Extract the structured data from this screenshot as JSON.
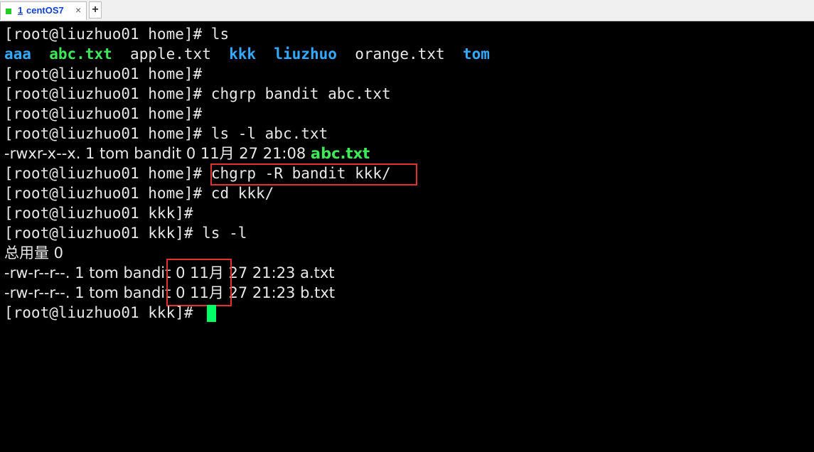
{
  "tab": {
    "number": "1",
    "title": "centOS7",
    "close": "×",
    "new_tab": "+"
  },
  "terminal": {
    "l1_prompt": "[root@liuzhuo01 home]#",
    "l1_cmd": " ls",
    "l2": {
      "aaa": "aaa",
      "abc": "abc.txt",
      "apple": "apple.txt",
      "kkk": "kkk",
      "liuzhuo": "liuzhuo",
      "orange": "orange.txt",
      "tom": "tom"
    },
    "l3": "[root@liuzhuo01 home]#",
    "l4_prompt": "[root@liuzhuo01 home]#",
    "l4_cmd": " chgrp bandit abc.txt",
    "l5": "[root@liuzhuo01 home]#",
    "l6_prompt": "[root@liuzhuo01 home]#",
    "l6_cmd": " ls -l abc.txt",
    "l7_meta": "-rwxr-x--x. 1 tom bandit 0 11月 27 21:08 ",
    "l7_file": "abc.txt",
    "l8_prompt": "[root@liuzhuo01 home]#",
    "l8_cmd": "chgrp -R bandit kkk/",
    "l9_prompt": "[root@liuzhuo01 home]#",
    "l9_cmd": " cd kkk/",
    "l10": "[root@liuzhuo01 kkk]#",
    "l11_prompt": "[root@liuzhuo01 kkk]#",
    "l11_cmd": " ls -l",
    "l12": "总用量 0",
    "l13_pre": "-rw-r--r--. 1 tom ",
    "l13_group": "bandit",
    "l13_post": " 0 11月 27 21:23 a.txt",
    "l14_pre": "-rw-r--r--. 1 tom ",
    "l14_group": "bandit",
    "l14_post": " 0 11月 27 21:23 b.txt",
    "l15_prompt": "[root@liuzhuo01 kkk]#"
  },
  "colors": {
    "directory": "#33aaff",
    "executable": "#3de85b",
    "highlight": "#e03030",
    "cursor": "#00ff66"
  }
}
